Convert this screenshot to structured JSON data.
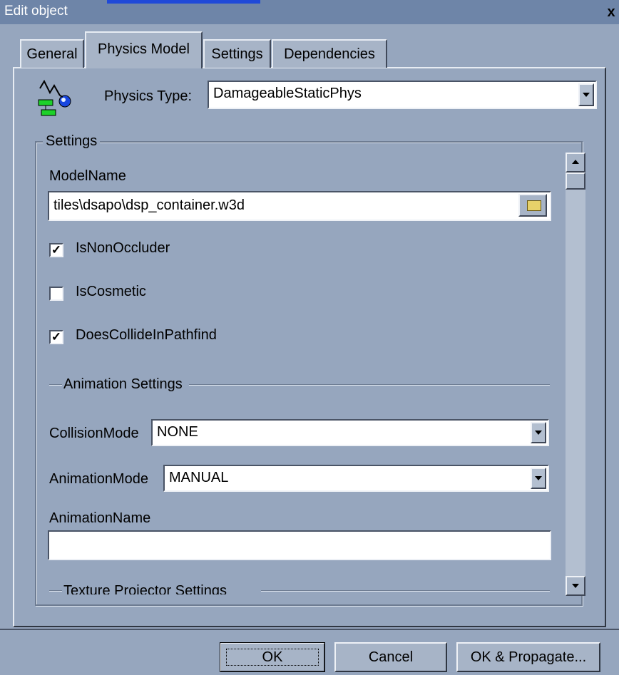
{
  "window": {
    "title": "Edit object",
    "close_glyph": "x"
  },
  "tabs": [
    {
      "label": "General"
    },
    {
      "label": "Physics Model"
    },
    {
      "label": "Settings"
    },
    {
      "label": "Dependencies"
    }
  ],
  "physics": {
    "type_label": "Physics Type:",
    "type_value": "DamageableStaticPhys",
    "icon": "physics-object-icon"
  },
  "settings_group": {
    "legend": "Settings",
    "model_name_label": "ModelName",
    "model_name_value": "tiles\\dsapo\\dsp_container.w3d",
    "browse_icon": "folder-icon",
    "checkboxes": [
      {
        "label": "IsNonOccluder",
        "checked": true
      },
      {
        "label": "IsCosmetic",
        "checked": false
      },
      {
        "label": "DoesCollideInPathfind",
        "checked": true
      }
    ],
    "animation_section": "Animation Settings",
    "collision_mode_label": "CollisionMode",
    "collision_mode_value": "NONE",
    "animation_mode_label": "AnimationMode",
    "animation_mode_value": "MANUAL",
    "animation_name_label": "AnimationName",
    "animation_name_value": "",
    "texture_section": "Texture Projector Settings"
  },
  "buttons": {
    "ok": "OK",
    "cancel": "Cancel",
    "ok_propagate": "OK & Propagate..."
  }
}
